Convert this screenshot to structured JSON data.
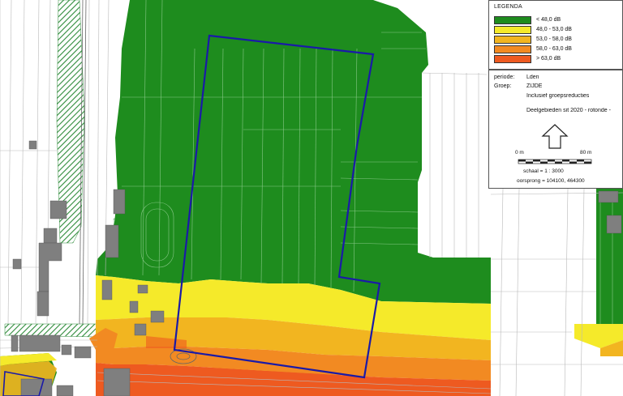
{
  "legend": {
    "title": "LEGENDA",
    "items": [
      {
        "label": "< 48,0 dB",
        "color": "#1e8c1e"
      },
      {
        "label": "48,0 - 53,0 dB",
        "color": "#f5ea2a"
      },
      {
        "label": "53,0 - 58,0 dB",
        "color": "#f2b520"
      },
      {
        "label": "58,0 - 63,0 dB",
        "color": "#f28a22"
      },
      {
        "label": "> 63,0 dB",
        "color": "#ee5a20"
      }
    ]
  },
  "info": {
    "periode_key": "periode:",
    "periode_value": "Lden",
    "groep_key": "Groep:",
    "groep_value": "ZIJDE",
    "groep_note": "Inclusief groepsreducties",
    "subset": "Deelgebieden sit 2020 - rotonde -"
  },
  "scale": {
    "start_label": "0 m",
    "end_label": "80 m",
    "ratio": "schaal = 1 : 3000",
    "origin": "oorsprong = 104100, 464300"
  },
  "map": {
    "outline_color": "#1a1aa8",
    "building_color": "#7f7f7f",
    "hatch_color": "#2e8b3a",
    "north_icon": "north-arrow-icon"
  }
}
